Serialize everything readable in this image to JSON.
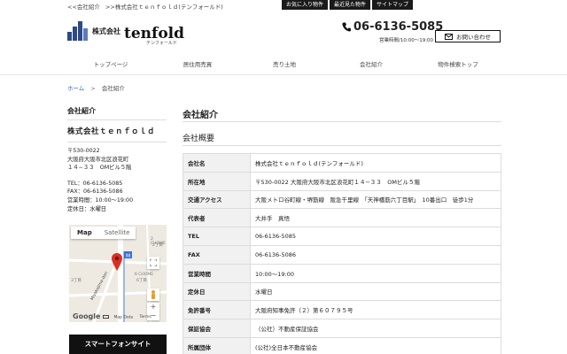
{
  "top": {
    "crumbs": [
      "<<会社紹介",
      ">>株式会社ｔｅｎｆｏｌｄ(テンフォールド)"
    ],
    "buttons": [
      "お気に入り物件",
      "最近見た物件",
      "サイトマップ"
    ]
  },
  "header": {
    "company_prefix": "株式会社",
    "brand": "tenfold",
    "brand_sub": "テンフォールド",
    "phone": "06-6136-5085",
    "hours": "営業時間/10:00〜19:00",
    "contact_label": "お問い合わせ"
  },
  "nav": [
    "トップページ",
    "居住用売買",
    "売り土地",
    "会社紹介",
    "物件検索トップ"
  ],
  "breadcrumb": {
    "home": "ホーム",
    "sep": ">",
    "current": "会社紹介"
  },
  "sidebar": {
    "heading": "会社紹介",
    "company": "株式会社ｔｅｎｆｏｌｄ",
    "address_lines": [
      "〒530-0022",
      "大阪府大阪市北区浪花町",
      "１４−３３　OMビル５階"
    ],
    "contact_lines": [
      "TEL：06-6136-5085",
      "FAX：06-6136-5086",
      "営業時間：10:00〜19:00",
      "定休日：水曜日"
    ],
    "map": {
      "tab_map": "Map",
      "tab_satellite": "Satellite",
      "google": "Google",
      "footer": [
        "Map Data",
        "Terms"
      ],
      "labels": [
        "2 CHOME",
        "2丁目",
        "6 CHOME",
        "6丁目",
        "3丁目"
      ],
      "road": "Miyakojima-dori"
    },
    "smartphone_button": "スマートフォンサイト"
  },
  "main": {
    "title": "会社紹介",
    "subtitle": "会社概要",
    "rows": [
      {
        "k": "会社名",
        "v": "株式会社ｔｅｎｆｏｌｄ(テンフォールド)"
      },
      {
        "k": "所在地",
        "v": "〒530-0022 大阪府大阪市北区浪花町１４−３３　OMビル５階"
      },
      {
        "k": "交通アクセス",
        "v": "大阪メトロ谷町線・堺筋線　阪急千里線　「天神橋筋六丁目駅」　10番出口　徒歩1分"
      },
      {
        "k": "代表者",
        "v": "大井手　真悟"
      },
      {
        "k": "TEL",
        "v": "06-6136-5085"
      },
      {
        "k": "FAX",
        "v": "06-6136-5086"
      },
      {
        "k": "営業時間",
        "v": "10:00〜19:00"
      },
      {
        "k": "定休日",
        "v": "水曜日"
      },
      {
        "k": "免許番号",
        "v": "大阪府知事免許（２）第６０７９５号"
      },
      {
        "k": "保証協会",
        "v": "（公社）不動産保証協会"
      },
      {
        "k": "所属団体",
        "v": "(公社)全日本不動産協会"
      }
    ]
  },
  "colors": {
    "brand_blue": "#2c4a86",
    "link_blue": "#3a67b0",
    "pin_red": "#d93025"
  }
}
